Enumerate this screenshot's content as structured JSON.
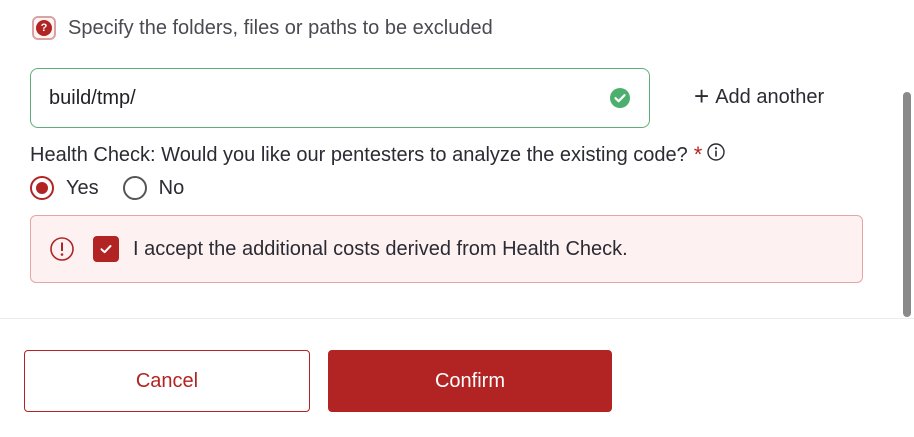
{
  "exclusions": {
    "help_text": "Specify the folders, files or paths to be excluded",
    "path_value": "build/tmp/",
    "add_another_label": "Add another"
  },
  "health_check": {
    "question": "Health Check: Would you like our pentesters to analyze the existing code?",
    "required_mark": "*",
    "options": [
      {
        "label": "Yes",
        "selected": true
      },
      {
        "label": "No",
        "selected": false
      }
    ],
    "accept_text": "I accept the additional costs derived from Health Check.",
    "accept_checked": true
  },
  "footer": {
    "cancel_label": "Cancel",
    "confirm_label": "Confirm"
  },
  "colors": {
    "brand": "#b22424",
    "valid": "#4caf6e",
    "warning_bg": "#fdf1f1"
  }
}
